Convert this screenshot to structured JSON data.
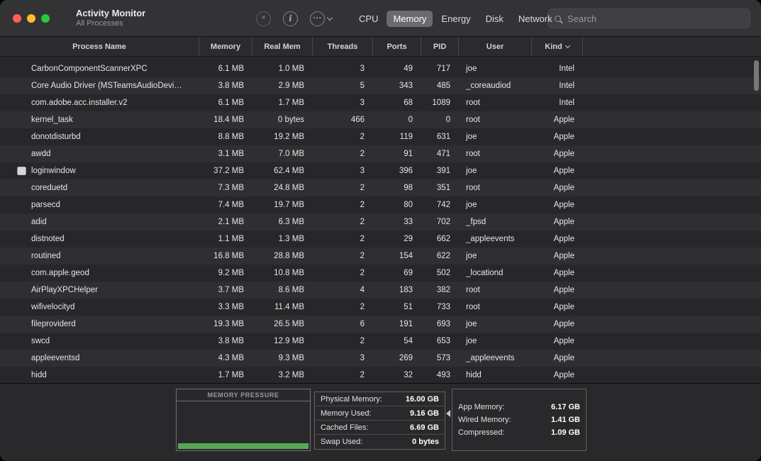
{
  "window": {
    "title": "Activity Monitor",
    "subtitle": "All Processes"
  },
  "toolbar": {
    "quit_button": "quit-process",
    "inspect_button": "inspect-process",
    "more_button": "more-options",
    "tabs": [
      {
        "label": "CPU",
        "selected": false
      },
      {
        "label": "Memory",
        "selected": true
      },
      {
        "label": "Energy",
        "selected": false
      },
      {
        "label": "Disk",
        "selected": false
      },
      {
        "label": "Network",
        "selected": false
      }
    ],
    "search_placeholder": "Search"
  },
  "table": {
    "columns": [
      {
        "key": "name",
        "label": "Process Name"
      },
      {
        "key": "memory",
        "label": "Memory"
      },
      {
        "key": "real_mem",
        "label": "Real Mem"
      },
      {
        "key": "threads",
        "label": "Threads"
      },
      {
        "key": "ports",
        "label": "Ports"
      },
      {
        "key": "pid",
        "label": "PID"
      },
      {
        "key": "user",
        "label": "User"
      },
      {
        "key": "kind",
        "label": "Kind"
      }
    ],
    "sort_column": "kind",
    "sort_direction": "desc",
    "rows": [
      {
        "name": "CarbonComponentScannerXPC",
        "memory": "6.1 MB",
        "real_mem": "1.0 MB",
        "threads": "3",
        "ports": "49",
        "pid": "717",
        "user": "joe",
        "kind": "Intel"
      },
      {
        "name": "Core Audio Driver (MSTeamsAudioDevi…",
        "memory": "3.8 MB",
        "real_mem": "2.9 MB",
        "threads": "5",
        "ports": "343",
        "pid": "485",
        "user": "_coreaudiod",
        "kind": "Intel"
      },
      {
        "name": "com.adobe.acc.installer.v2",
        "memory": "6.1 MB",
        "real_mem": "1.7 MB",
        "threads": "3",
        "ports": "68",
        "pid": "1089",
        "user": "root",
        "kind": "Intel"
      },
      {
        "name": "kernel_task",
        "memory": "18.4 MB",
        "real_mem": "0 bytes",
        "threads": "466",
        "ports": "0",
        "pid": "0",
        "user": "root",
        "kind": "Apple"
      },
      {
        "name": "donotdisturbd",
        "memory": "8.8 MB",
        "real_mem": "19.2 MB",
        "threads": "2",
        "ports": "119",
        "pid": "631",
        "user": "joe",
        "kind": "Apple"
      },
      {
        "name": "awdd",
        "memory": "3.1 MB",
        "real_mem": "7.0 MB",
        "threads": "2",
        "ports": "91",
        "pid": "471",
        "user": "root",
        "kind": "Apple"
      },
      {
        "name": "loginwindow",
        "memory": "37.2 MB",
        "real_mem": "62.4 MB",
        "threads": "3",
        "ports": "396",
        "pid": "391",
        "user": "joe",
        "kind": "Apple",
        "has_icon": true
      },
      {
        "name": "coreduetd",
        "memory": "7.3 MB",
        "real_mem": "24.8 MB",
        "threads": "2",
        "ports": "98",
        "pid": "351",
        "user": "root",
        "kind": "Apple"
      },
      {
        "name": "parsecd",
        "memory": "7.4 MB",
        "real_mem": "19.7 MB",
        "threads": "2",
        "ports": "80",
        "pid": "742",
        "user": "joe",
        "kind": "Apple"
      },
      {
        "name": "adid",
        "memory": "2.1 MB",
        "real_mem": "6.3 MB",
        "threads": "2",
        "ports": "33",
        "pid": "702",
        "user": "_fpsd",
        "kind": "Apple"
      },
      {
        "name": "distnoted",
        "memory": "1.1 MB",
        "real_mem": "1.3 MB",
        "threads": "2",
        "ports": "29",
        "pid": "662",
        "user": "_appleevents",
        "kind": "Apple"
      },
      {
        "name": "routined",
        "memory": "16.8 MB",
        "real_mem": "28.8 MB",
        "threads": "2",
        "ports": "154",
        "pid": "622",
        "user": "joe",
        "kind": "Apple"
      },
      {
        "name": "com.apple.geod",
        "memory": "9.2 MB",
        "real_mem": "10.8 MB",
        "threads": "2",
        "ports": "69",
        "pid": "502",
        "user": "_locationd",
        "kind": "Apple"
      },
      {
        "name": "AirPlayXPCHelper",
        "memory": "3.7 MB",
        "real_mem": "8.6 MB",
        "threads": "4",
        "ports": "183",
        "pid": "382",
        "user": "root",
        "kind": "Apple"
      },
      {
        "name": "wifivelocityd",
        "memory": "3.3 MB",
        "real_mem": "11.4 MB",
        "threads": "2",
        "ports": "51",
        "pid": "733",
        "user": "root",
        "kind": "Apple"
      },
      {
        "name": "fileproviderd",
        "memory": "19.3 MB",
        "real_mem": "26.5 MB",
        "threads": "6",
        "ports": "191",
        "pid": "693",
        "user": "joe",
        "kind": "Apple"
      },
      {
        "name": "swcd",
        "memory": "3.8 MB",
        "real_mem": "12.9 MB",
        "threads": "2",
        "ports": "54",
        "pid": "653",
        "user": "joe",
        "kind": "Apple"
      },
      {
        "name": "appleeventsd",
        "memory": "4.3 MB",
        "real_mem": "9.3 MB",
        "threads": "3",
        "ports": "269",
        "pid": "573",
        "user": "_appleevents",
        "kind": "Apple"
      },
      {
        "name": "hidd",
        "memory": "1.7 MB",
        "real_mem": "3.2 MB",
        "threads": "2",
        "ports": "32",
        "pid": "493",
        "user": "hidd",
        "kind": "Apple"
      }
    ]
  },
  "footer": {
    "pressure_title": "MEMORY PRESSURE",
    "pressure_level_percent": 6,
    "stats_left": [
      {
        "label": "Physical Memory:",
        "value": "16.00 GB"
      },
      {
        "label": "Memory Used:",
        "value": "9.16 GB"
      },
      {
        "label": "Cached Files:",
        "value": "6.69 GB"
      },
      {
        "label": "Swap Used:",
        "value": "0 bytes"
      }
    ],
    "stats_right": [
      {
        "label": "App Memory:",
        "value": "6.17 GB"
      },
      {
        "label": "Wired Memory:",
        "value": "1.41 GB"
      },
      {
        "label": "Compressed:",
        "value": "1.09 GB"
      }
    ]
  },
  "colors": {
    "close_red": "#ff5f57",
    "minimize_yellow": "#febc2e",
    "zoom_green": "#28c840",
    "selected_tab_gray": "#6a6a6f",
    "memory_pressure_green": "#57a757"
  }
}
